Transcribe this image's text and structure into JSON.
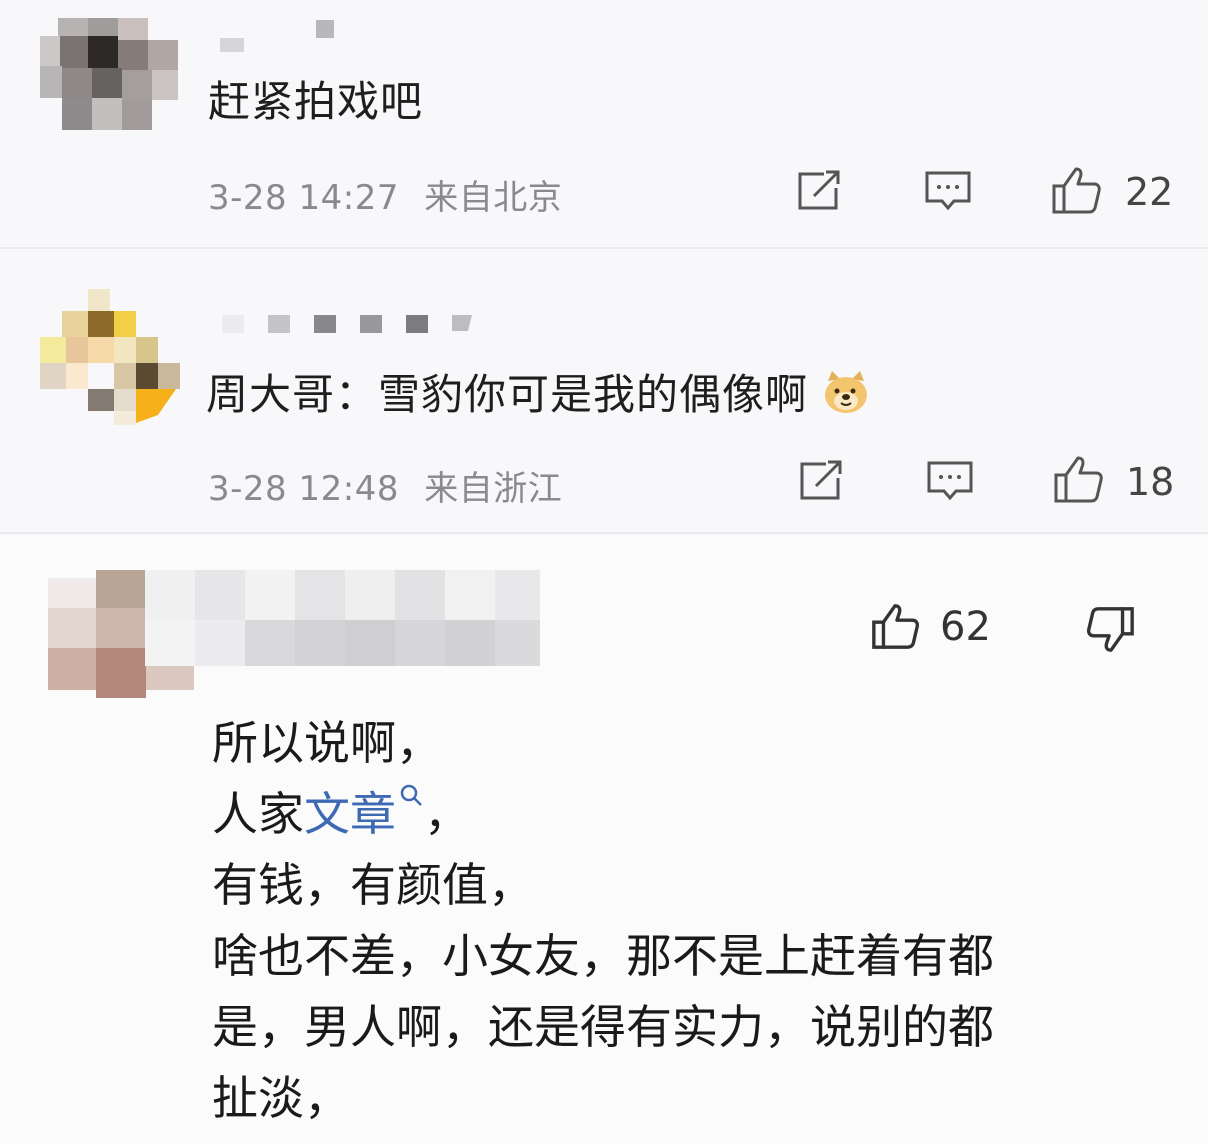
{
  "comments": [
    {
      "text": "赶紧拍戏吧",
      "time": "3-28 14:27",
      "location": "来自北京",
      "likes": "22",
      "icons": [
        "share-icon",
        "comment-icon",
        "like-icon"
      ]
    },
    {
      "text": "周大哥：雪豹你可是我的偶像啊",
      "emoji": "doge-emoji",
      "time": "3-28 12:48",
      "location": "来自浙江",
      "likes": "18",
      "icons": [
        "share-icon",
        "comment-icon",
        "like-icon"
      ]
    },
    {
      "likes": "62",
      "icons": [
        "like-icon",
        "dislike-icon"
      ],
      "lines": {
        "l1": "所以说啊，",
        "l2_pre": "人家",
        "l2_link": "文章",
        "l2_post": "，",
        "l3": "有钱，有颜值，",
        "l4": "啥也不差，小女友，那不是上赶着有都",
        "l5": "是，男人啊，还是得有实力，说别的都",
        "l6": "扯淡，"
      }
    }
  ],
  "colors": {
    "link": "#3e6ab4",
    "meta_text": "#8a8a8e",
    "body_text": "#1e1e1e"
  }
}
